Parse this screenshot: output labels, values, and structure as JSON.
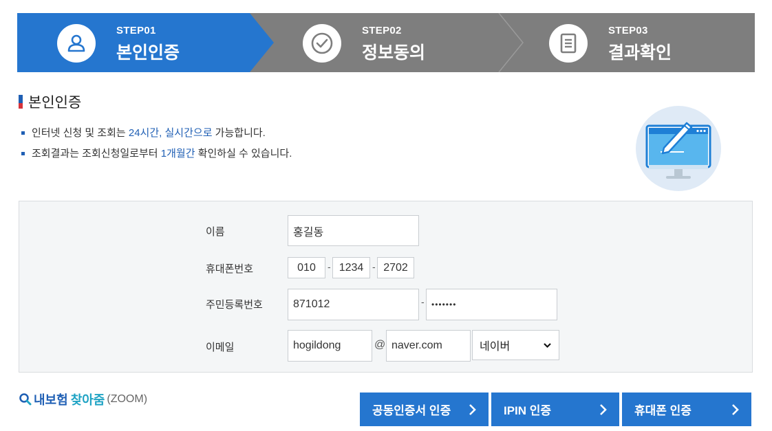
{
  "steps": [
    {
      "no": "STEP01",
      "title": "본인인증",
      "icon": "user-icon",
      "active": true
    },
    {
      "no": "STEP02",
      "title": "정보동의",
      "icon": "check-circle-icon",
      "active": false
    },
    {
      "no": "STEP03",
      "title": "결과확인",
      "icon": "document-icon",
      "active": false
    }
  ],
  "colors": {
    "active_step": "#2576cf",
    "inactive_step": "#7e7e7e",
    "accent": "#1f5fb4",
    "button": "#2576cf"
  },
  "section": {
    "title": "본인인증",
    "notice1": {
      "a": "인터넷 신청 및 조회는 ",
      "b": "24시간, 실시간으로",
      "c": " 가능합니다."
    },
    "notice2": {
      "a": "조회결과는 조회신청일로부터 ",
      "b": "1개월간",
      "c": " 확인하실 수 있습니다."
    }
  },
  "form": {
    "name_label": "이름",
    "name_value": "홍길동",
    "phone_label": "휴대폰번호",
    "phone1": "010",
    "phone2": "1234",
    "phone3": "2702",
    "phone_sep": "-",
    "rrn_label": "주민등록번호",
    "rrn_front": "871012",
    "rrn_back": "•••••••",
    "email_label": "이메일",
    "email_id": "hogildong",
    "email_at": "@",
    "email_domain": "naver.com",
    "email_select": "네이버"
  },
  "logo": {
    "part1": "내보험",
    "part2": "찾아줌",
    "part3": "(ZOOM)"
  },
  "buttons": {
    "cert": "공동인증서 인증",
    "ipin": "IPIN 인증",
    "phone": "휴대폰 인증"
  }
}
